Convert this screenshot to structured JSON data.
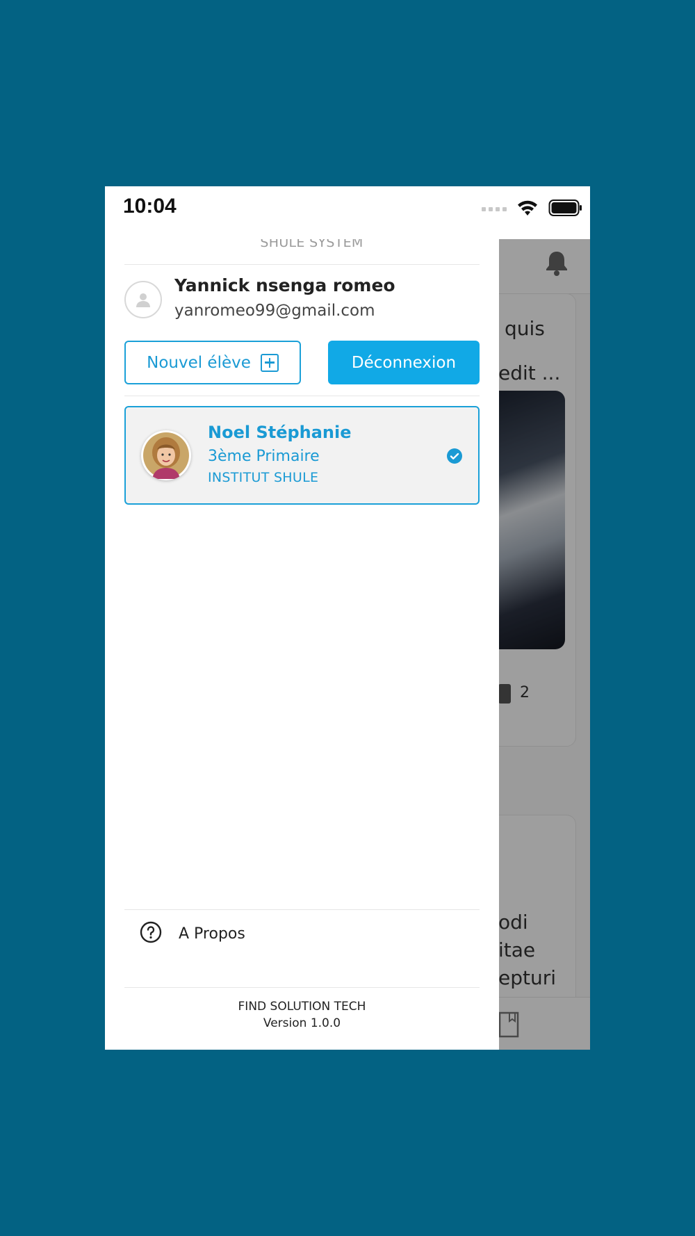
{
  "status_bar": {
    "time": "10:04"
  },
  "drawer": {
    "title": "SHULE SYSTEM",
    "user": {
      "name": "Yannick nsenga romeo",
      "email": "yanromeo99@gmail.com"
    },
    "buttons": {
      "new_student": "Nouvel élève",
      "logout": "Déconnexion"
    },
    "students": [
      {
        "name": "Noel Stéphanie",
        "class": "3ème Primaire",
        "school": "INSTITUT SHULE",
        "selected": true
      }
    ],
    "menu": [
      {
        "label": "A Propos",
        "icon": "question-circle-icon"
      }
    ],
    "footer": {
      "company": "FIND SOLUTION TECH",
      "version": "Version 1.0.0"
    }
  },
  "background_app": {
    "text_fragments": [
      "quis",
      "edit ...",
      "2",
      "odi",
      "itae",
      "epturi"
    ]
  },
  "colors": {
    "accent": "#1a9ad4",
    "button_fill": "#11a9e6",
    "page_bg": "#036283"
  }
}
